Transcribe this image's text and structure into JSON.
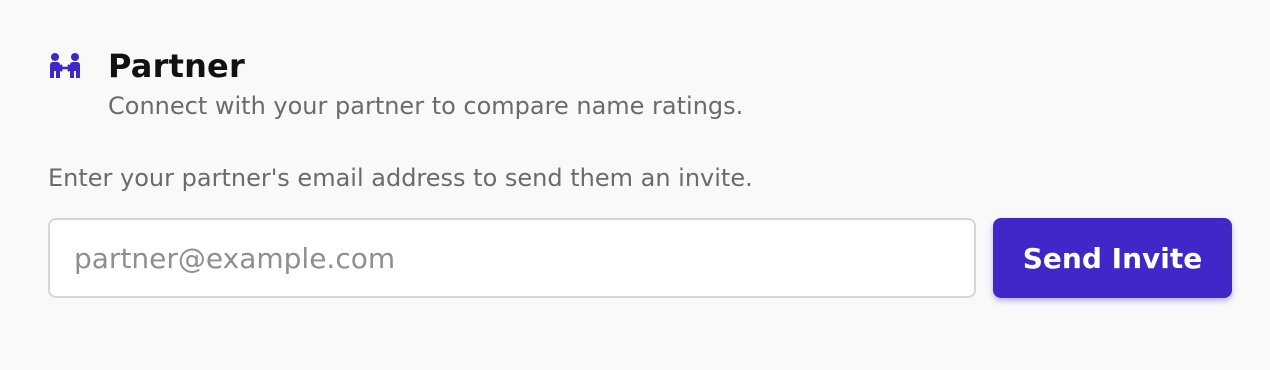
{
  "partner": {
    "icon": "partner-people-icon",
    "title": "Partner",
    "subtitle": "Connect with your partner to compare name ratings.",
    "instructions": "Enter your partner's email address to send them an invite.",
    "email_placeholder": "partner@example.com",
    "email_value": "",
    "send_label": "Send Invite"
  },
  "colors": {
    "accent": "#3f27c8",
    "background": "#f9f9f9",
    "text_primary": "#111111",
    "text_secondary": "#6b6b6b"
  }
}
